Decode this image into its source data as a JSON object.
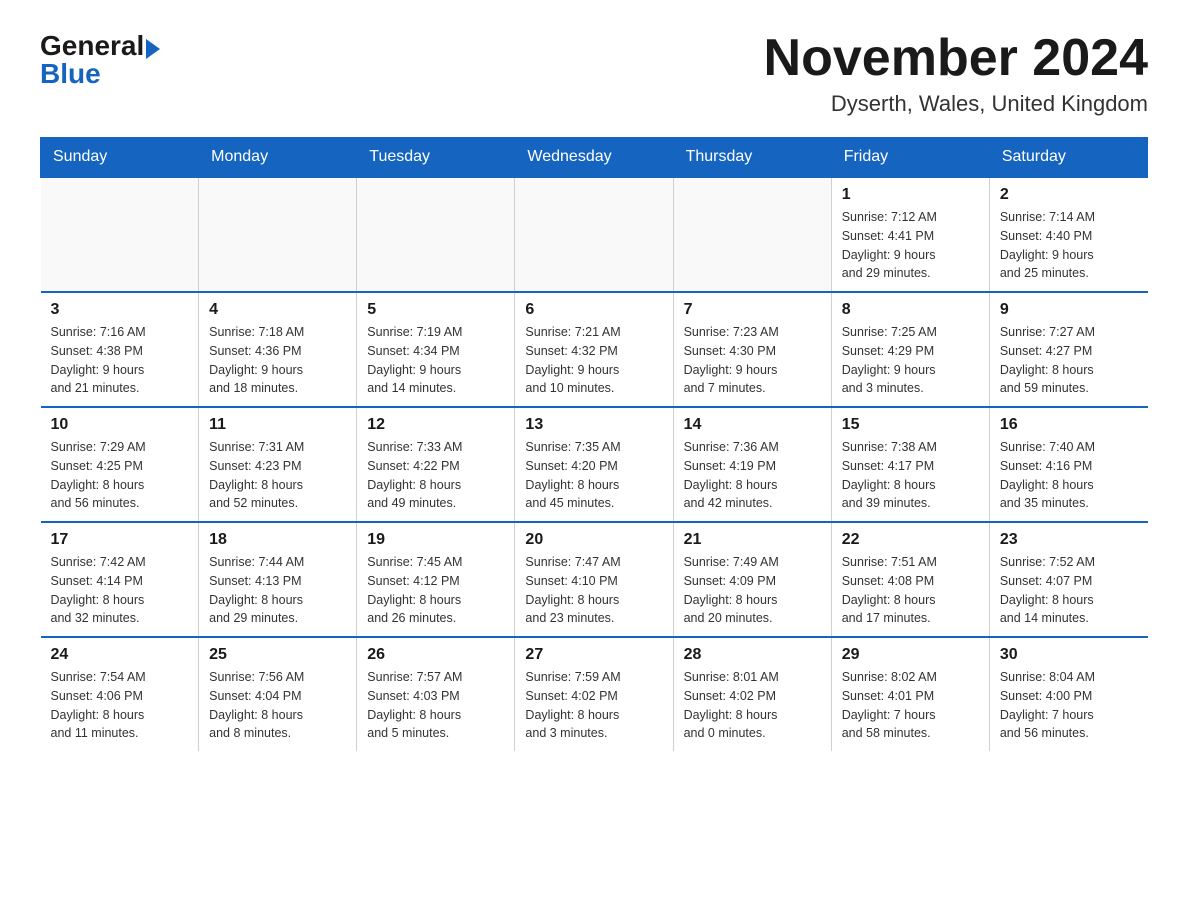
{
  "logo": {
    "general": "General",
    "blue": "Blue"
  },
  "title": "November 2024",
  "subtitle": "Dyserth, Wales, United Kingdom",
  "headers": [
    "Sunday",
    "Monday",
    "Tuesday",
    "Wednesday",
    "Thursday",
    "Friday",
    "Saturday"
  ],
  "weeks": [
    [
      {
        "day": "",
        "info": ""
      },
      {
        "day": "",
        "info": ""
      },
      {
        "day": "",
        "info": ""
      },
      {
        "day": "",
        "info": ""
      },
      {
        "day": "",
        "info": ""
      },
      {
        "day": "1",
        "info": "Sunrise: 7:12 AM\nSunset: 4:41 PM\nDaylight: 9 hours\nand 29 minutes."
      },
      {
        "day": "2",
        "info": "Sunrise: 7:14 AM\nSunset: 4:40 PM\nDaylight: 9 hours\nand 25 minutes."
      }
    ],
    [
      {
        "day": "3",
        "info": "Sunrise: 7:16 AM\nSunset: 4:38 PM\nDaylight: 9 hours\nand 21 minutes."
      },
      {
        "day": "4",
        "info": "Sunrise: 7:18 AM\nSunset: 4:36 PM\nDaylight: 9 hours\nand 18 minutes."
      },
      {
        "day": "5",
        "info": "Sunrise: 7:19 AM\nSunset: 4:34 PM\nDaylight: 9 hours\nand 14 minutes."
      },
      {
        "day": "6",
        "info": "Sunrise: 7:21 AM\nSunset: 4:32 PM\nDaylight: 9 hours\nand 10 minutes."
      },
      {
        "day": "7",
        "info": "Sunrise: 7:23 AM\nSunset: 4:30 PM\nDaylight: 9 hours\nand 7 minutes."
      },
      {
        "day": "8",
        "info": "Sunrise: 7:25 AM\nSunset: 4:29 PM\nDaylight: 9 hours\nand 3 minutes."
      },
      {
        "day": "9",
        "info": "Sunrise: 7:27 AM\nSunset: 4:27 PM\nDaylight: 8 hours\nand 59 minutes."
      }
    ],
    [
      {
        "day": "10",
        "info": "Sunrise: 7:29 AM\nSunset: 4:25 PM\nDaylight: 8 hours\nand 56 minutes."
      },
      {
        "day": "11",
        "info": "Sunrise: 7:31 AM\nSunset: 4:23 PM\nDaylight: 8 hours\nand 52 minutes."
      },
      {
        "day": "12",
        "info": "Sunrise: 7:33 AM\nSunset: 4:22 PM\nDaylight: 8 hours\nand 49 minutes."
      },
      {
        "day": "13",
        "info": "Sunrise: 7:35 AM\nSunset: 4:20 PM\nDaylight: 8 hours\nand 45 minutes."
      },
      {
        "day": "14",
        "info": "Sunrise: 7:36 AM\nSunset: 4:19 PM\nDaylight: 8 hours\nand 42 minutes."
      },
      {
        "day": "15",
        "info": "Sunrise: 7:38 AM\nSunset: 4:17 PM\nDaylight: 8 hours\nand 39 minutes."
      },
      {
        "day": "16",
        "info": "Sunrise: 7:40 AM\nSunset: 4:16 PM\nDaylight: 8 hours\nand 35 minutes."
      }
    ],
    [
      {
        "day": "17",
        "info": "Sunrise: 7:42 AM\nSunset: 4:14 PM\nDaylight: 8 hours\nand 32 minutes."
      },
      {
        "day": "18",
        "info": "Sunrise: 7:44 AM\nSunset: 4:13 PM\nDaylight: 8 hours\nand 29 minutes."
      },
      {
        "day": "19",
        "info": "Sunrise: 7:45 AM\nSunset: 4:12 PM\nDaylight: 8 hours\nand 26 minutes."
      },
      {
        "day": "20",
        "info": "Sunrise: 7:47 AM\nSunset: 4:10 PM\nDaylight: 8 hours\nand 23 minutes."
      },
      {
        "day": "21",
        "info": "Sunrise: 7:49 AM\nSunset: 4:09 PM\nDaylight: 8 hours\nand 20 minutes."
      },
      {
        "day": "22",
        "info": "Sunrise: 7:51 AM\nSunset: 4:08 PM\nDaylight: 8 hours\nand 17 minutes."
      },
      {
        "day": "23",
        "info": "Sunrise: 7:52 AM\nSunset: 4:07 PM\nDaylight: 8 hours\nand 14 minutes."
      }
    ],
    [
      {
        "day": "24",
        "info": "Sunrise: 7:54 AM\nSunset: 4:06 PM\nDaylight: 8 hours\nand 11 minutes."
      },
      {
        "day": "25",
        "info": "Sunrise: 7:56 AM\nSunset: 4:04 PM\nDaylight: 8 hours\nand 8 minutes."
      },
      {
        "day": "26",
        "info": "Sunrise: 7:57 AM\nSunset: 4:03 PM\nDaylight: 8 hours\nand 5 minutes."
      },
      {
        "day": "27",
        "info": "Sunrise: 7:59 AM\nSunset: 4:02 PM\nDaylight: 8 hours\nand 3 minutes."
      },
      {
        "day": "28",
        "info": "Sunrise: 8:01 AM\nSunset: 4:02 PM\nDaylight: 8 hours\nand 0 minutes."
      },
      {
        "day": "29",
        "info": "Sunrise: 8:02 AM\nSunset: 4:01 PM\nDaylight: 7 hours\nand 58 minutes."
      },
      {
        "day": "30",
        "info": "Sunrise: 8:04 AM\nSunset: 4:00 PM\nDaylight: 7 hours\nand 56 minutes."
      }
    ]
  ]
}
